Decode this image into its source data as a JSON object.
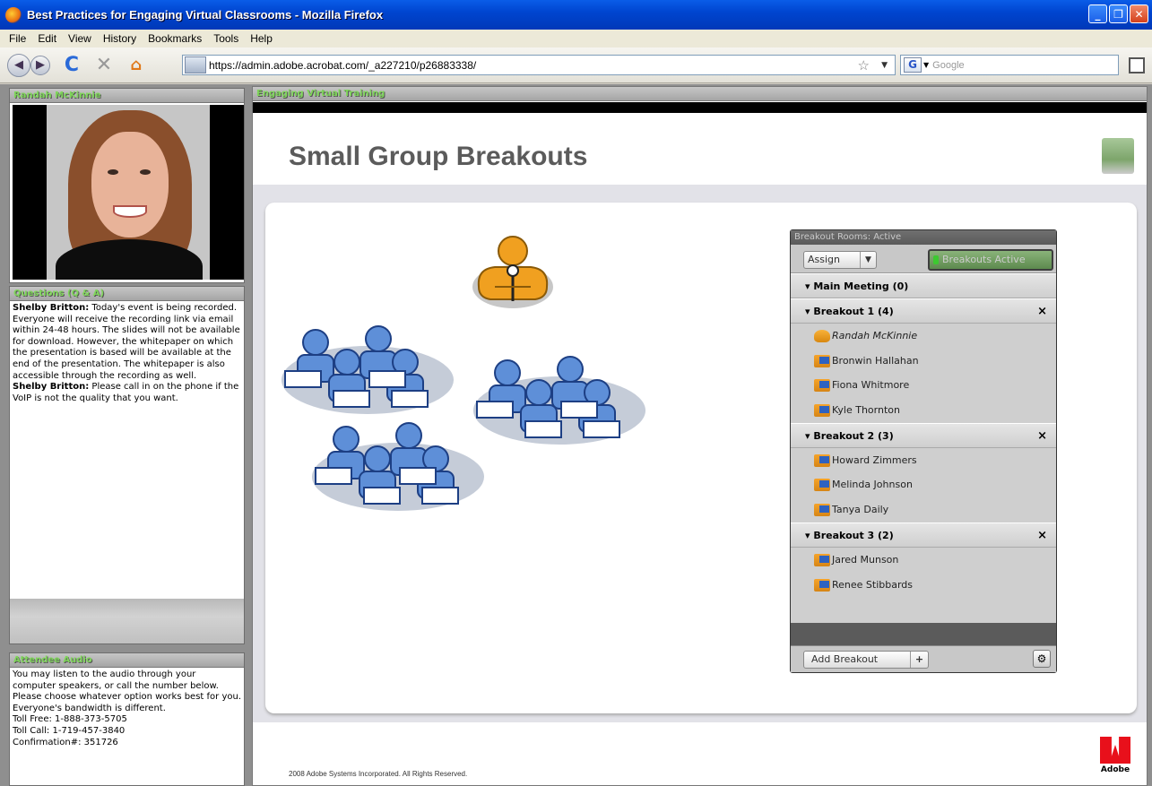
{
  "window": {
    "title": "Best Practices for Engaging Virtual Classrooms - Mozilla Firefox",
    "buttons": [
      "_",
      "❐",
      "✕"
    ]
  },
  "menu": {
    "items": [
      "File",
      "Edit",
      "View",
      "History",
      "Bookmarks",
      "Tools",
      "Help"
    ]
  },
  "nav": {
    "url": "https://admin.adobe.acrobat.com/_a227210/p26883338/",
    "search_engine": "Google",
    "search_placeholder": "Google",
    "icons": [
      "back-icon",
      "forward-icon",
      "reload-icon",
      "stop-icon",
      "home-icon",
      "bookmark-star-icon",
      "search-icon"
    ]
  },
  "camera_pod": {
    "title": "Randah McKinnie"
  },
  "qa_pod": {
    "title": "Questions (Q & A)",
    "messages": [
      {
        "author": "Shelby Britton:",
        "text": " Today's event is being recorded. Everyone will receive the recording link via email within 24-48 hours. The slides will not be available for download. However, the whitepaper on which the presentation is based will be available at the end of the presentation.  The whitepaper is also accessible through the recording as well."
      },
      {
        "author": "Shelby Britton:",
        "text": " Please call in on the phone if the VoIP is not the quality that you want."
      }
    ]
  },
  "audio_pod": {
    "title": "Attendee Audio",
    "lines": [
      "You may listen to the audio through your computer speakers, or call the number below. Please choose whatever option works best for you. Everyone's bandwidth is different.",
      "Toll Free: 1-888-373-5705",
      "Toll Call: 1-719-457-3840",
      "Confirmation#: 351726"
    ]
  },
  "share_pod": {
    "title": "Engaging Virtual Training",
    "slide_title": "Small Group Breakouts",
    "copyright": "2008 Adobe Systems Incorporated. All Rights Reserved.",
    "brand": "Adobe"
  },
  "breakout_panel": {
    "header": "Breakout Rooms: Active",
    "assign_label": "Assign",
    "status_button": "Breakouts Active",
    "add_label": "Add Breakout",
    "groups": [
      {
        "label": "Main Meeting  (0)",
        "closable": false,
        "members": []
      },
      {
        "label": "Breakout 1  (4)",
        "closable": true,
        "members": [
          {
            "name": "Randah McKinnie",
            "host": true
          },
          {
            "name": "Bronwin Hallahan",
            "host": false
          },
          {
            "name": "Fiona Whitmore",
            "host": false
          },
          {
            "name": "Kyle Thornton",
            "host": false
          }
        ]
      },
      {
        "label": "Breakout 2  (3)",
        "closable": true,
        "members": [
          {
            "name": "Howard Zimmers",
            "host": false
          },
          {
            "name": "Melinda Johnson",
            "host": false
          },
          {
            "name": "Tanya Daily",
            "host": false
          }
        ]
      },
      {
        "label": "Breakout 3  (2)",
        "closable": true,
        "members": [
          {
            "name": "Jared Munson",
            "host": false
          },
          {
            "name": "Renee Stibbards",
            "host": false
          }
        ]
      }
    ]
  },
  "colors": {
    "pod_title_text": "#7fd65a",
    "accent_orange": "#f0a020",
    "people_blue": "#2e62c0"
  }
}
